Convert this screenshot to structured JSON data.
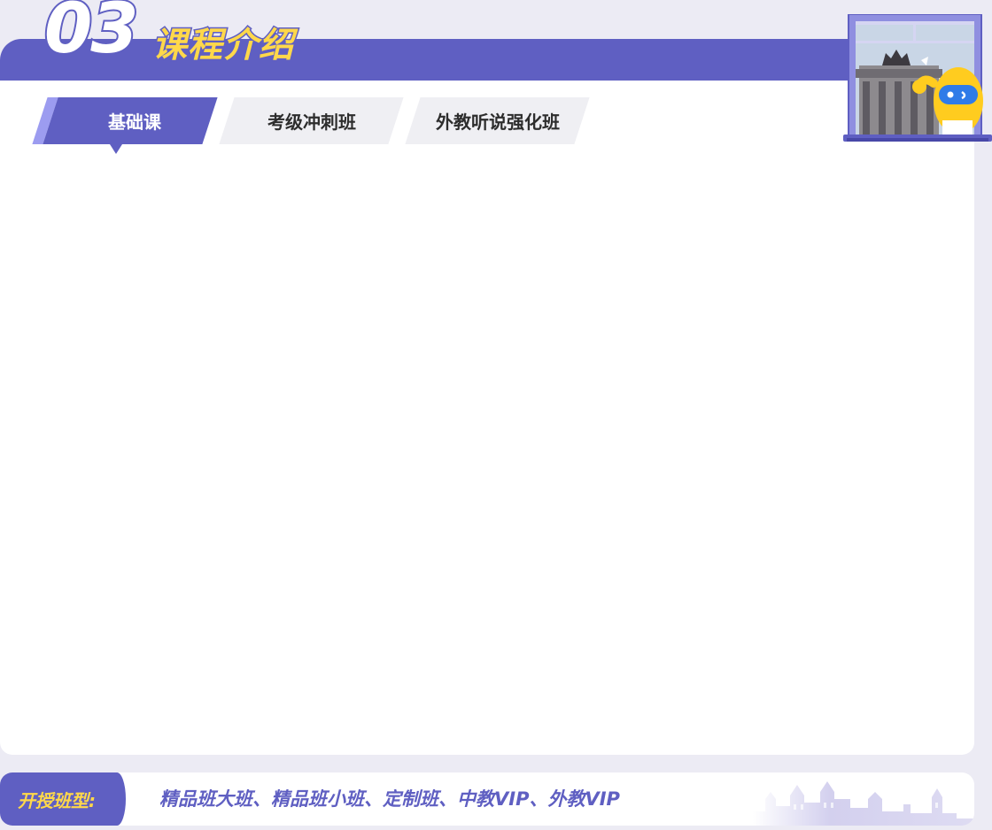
{
  "header": {
    "section_number": "03",
    "section_title": "课程介绍"
  },
  "tabs": [
    {
      "label": "基础课",
      "active": true
    },
    {
      "label": "考级冲刺班",
      "active": false
    },
    {
      "label": "外教听说强化班",
      "active": false
    }
  ],
  "footer": {
    "label": "开授班型:",
    "value": "精品班大班、精品班小班、定制班、中教VIP、外教VIP"
  },
  "colors": {
    "primary": "#5f5fc2",
    "accent_yellow": "#ffd84a",
    "page_background": "#ecebf4",
    "tab_inactive": "#efeff3"
  },
  "icons": {
    "window": "window-illustration",
    "castle": "castle-decoration"
  }
}
